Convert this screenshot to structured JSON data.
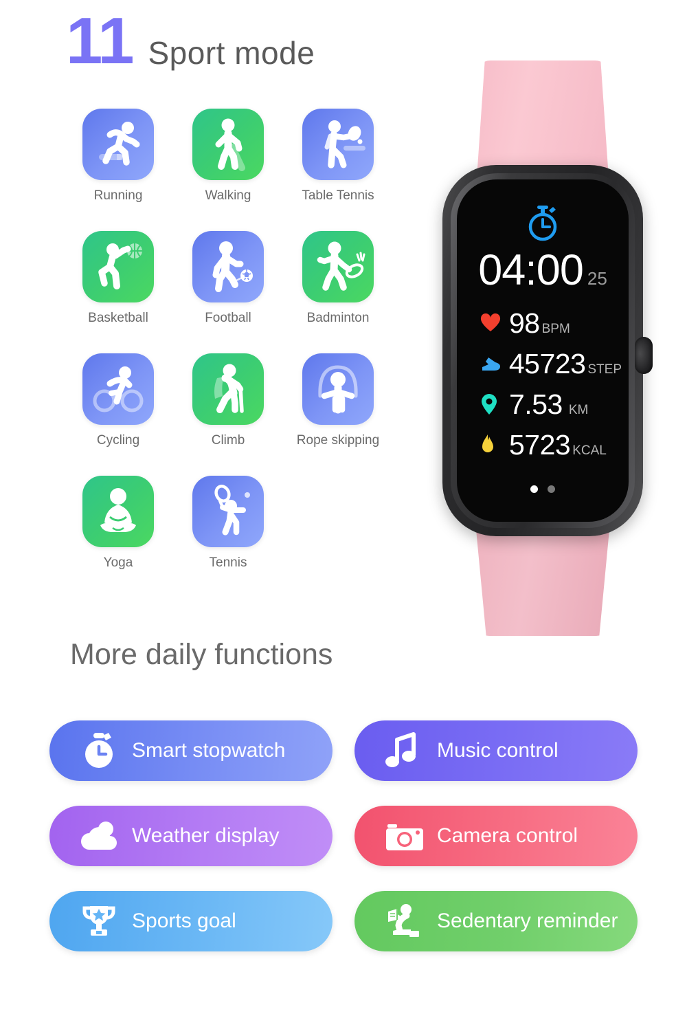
{
  "header": {
    "number": "11",
    "title": "Sport mode",
    "accent_color": "#7a73f5"
  },
  "sports": [
    {
      "label": "Running",
      "icon": "running-icon",
      "tile": "blue"
    },
    {
      "label": "Walking",
      "icon": "walking-icon",
      "tile": "green"
    },
    {
      "label": "Table Tennis",
      "icon": "table-tennis-icon",
      "tile": "blue"
    },
    {
      "label": "Basketball",
      "icon": "basketball-icon",
      "tile": "green"
    },
    {
      "label": "Football",
      "icon": "football-icon",
      "tile": "blue"
    },
    {
      "label": "Badminton",
      "icon": "badminton-icon",
      "tile": "green"
    },
    {
      "label": "Cycling",
      "icon": "cycling-icon",
      "tile": "blue"
    },
    {
      "label": "Climb",
      "icon": "climb-icon",
      "tile": "green"
    },
    {
      "label": "Rope skipping",
      "icon": "rope-skipping-icon",
      "tile": "blue"
    },
    {
      "label": "Yoga",
      "icon": "yoga-icon",
      "tile": "green"
    },
    {
      "label": "Tennis",
      "icon": "tennis-icon",
      "tile": "blue"
    }
  ],
  "watch": {
    "band_color": "#f7bdc9",
    "case_color": "#2a2a2c",
    "screen_color": "#070707",
    "app_icon": "stopwatch-icon",
    "app_icon_color": "#1f9cf0",
    "timer": "04:00",
    "timer_centiseconds": "25",
    "metrics": [
      {
        "icon": "heart-icon",
        "icon_color": "#f4402e",
        "value": "98",
        "unit": "BPM"
      },
      {
        "icon": "shoe-icon",
        "icon_color": "#3aa6f0",
        "value": "45723",
        "unit": "STEP"
      },
      {
        "icon": "location-icon",
        "icon_color": "#1fe0c4",
        "value": "7.53",
        "unit": "KM"
      },
      {
        "icon": "flame-icon",
        "icon_color": "#f5d13b",
        "value": "5723",
        "unit": "KCAL"
      }
    ],
    "page_dots": {
      "total": 2,
      "active_index": 0
    }
  },
  "functions_section": {
    "title": "More daily functions",
    "pills": [
      {
        "label": "Smart stopwatch",
        "icon": "stopwatch-icon",
        "style": "pill-stopwatch",
        "color": "#5a74ee"
      },
      {
        "label": "Music control",
        "icon": "music-note-icon",
        "style": "pill-music",
        "color": "#6a5df0"
      },
      {
        "label": "Weather display",
        "icon": "cloud-sun-icon",
        "style": "pill-weather",
        "color": "#a263ef"
      },
      {
        "label": "Camera control",
        "icon": "camera-icon",
        "style": "pill-camera",
        "color": "#f2526e"
      },
      {
        "label": "Sports goal",
        "icon": "trophy-icon",
        "style": "pill-sports",
        "color": "#4fa6f0"
      },
      {
        "label": "Sedentary reminder",
        "icon": "sedentary-icon",
        "style": "pill-sedentary",
        "color": "#63c95f"
      }
    ]
  }
}
